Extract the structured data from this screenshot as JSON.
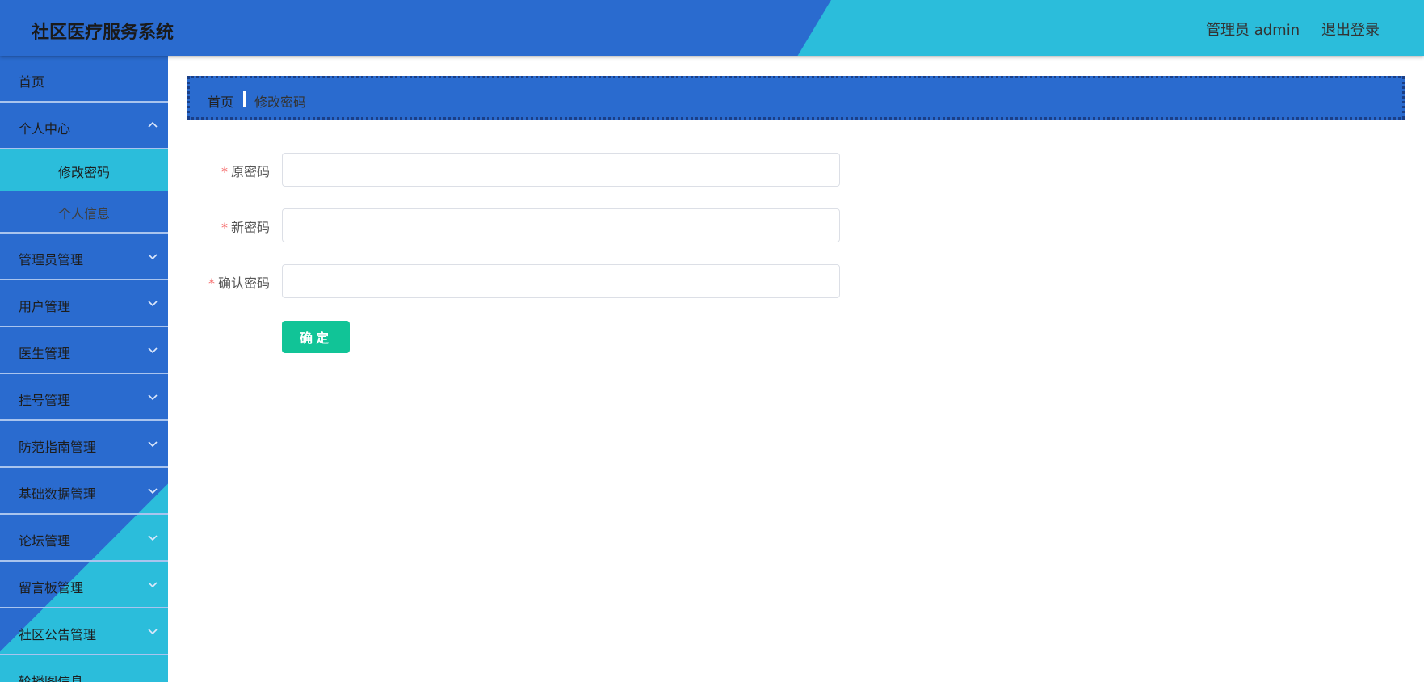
{
  "header": {
    "app_title": "社区医疗服务系统",
    "admin_label": "管理员 admin",
    "logout_label": "退出登录"
  },
  "sidebar": {
    "items": [
      {
        "label": "首页",
        "has_chevron": false
      },
      {
        "label": "个人中心",
        "has_chevron": true,
        "expanded": true,
        "children": [
          {
            "label": "修改密码",
            "active": true
          },
          {
            "label": "个人信息",
            "active": false
          }
        ]
      },
      {
        "label": "管理员管理",
        "has_chevron": true
      },
      {
        "label": "用户管理",
        "has_chevron": true
      },
      {
        "label": "医生管理",
        "has_chevron": true
      },
      {
        "label": "挂号管理",
        "has_chevron": true
      },
      {
        "label": "防范指南管理",
        "has_chevron": true
      },
      {
        "label": "基础数据管理",
        "has_chevron": true
      },
      {
        "label": "论坛管理",
        "has_chevron": true
      },
      {
        "label": "留言板管理",
        "has_chevron": true
      },
      {
        "label": "社区公告管理",
        "has_chevron": true
      },
      {
        "label": "轮播图信息",
        "has_chevron": false
      }
    ]
  },
  "breadcrumb": {
    "home": "首页",
    "current": "修改密码"
  },
  "form": {
    "required_mark": "*",
    "fields": [
      {
        "label": "原密码",
        "value": "",
        "placeholder": ""
      },
      {
        "label": "新密码",
        "value": "",
        "placeholder": ""
      },
      {
        "label": "确认密码",
        "value": "",
        "placeholder": ""
      }
    ],
    "submit_label": "确定"
  },
  "colors": {
    "primary_blue": "#2a6bcf",
    "accent_cyan": "#2bbddb",
    "submit_green": "#11c497",
    "required_red": "#f56c6c"
  }
}
